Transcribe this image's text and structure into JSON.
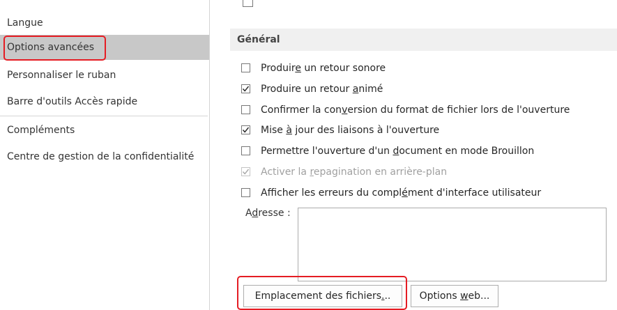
{
  "sidebar": {
    "items": [
      {
        "label": "Langue"
      },
      {
        "label": "Options avancées",
        "selected": true
      },
      {
        "label": "Personnaliser le ruban"
      },
      {
        "label": "Barre d'outils Accès rapide"
      },
      {
        "label": "Compléments"
      },
      {
        "label": "Centre de gestion de la confidentialité"
      }
    ]
  },
  "section": {
    "title": "Général"
  },
  "options": [
    {
      "pre": "Produir",
      "acc": "e",
      "post": " un retour sonore",
      "checked": false,
      "disabled": false
    },
    {
      "pre": "Produire un retour ",
      "acc": "a",
      "post": "nimé",
      "checked": true,
      "disabled": false
    },
    {
      "pre": "Confirmer la con",
      "acc": "v",
      "post": "ersion du format de fichier lors de l'ouverture",
      "checked": false,
      "disabled": false
    },
    {
      "pre": "Mise ",
      "acc": "à",
      "post": " jour des liaisons à l'ouverture",
      "checked": true,
      "disabled": false
    },
    {
      "pre": "Permettre l'ouverture d'un ",
      "acc": "d",
      "post": "ocument en mode Brouillon",
      "checked": false,
      "disabled": false
    },
    {
      "pre": "Activer la ",
      "acc": "r",
      "post": "epagination en arrière-plan",
      "checked": true,
      "disabled": true
    },
    {
      "pre": "Afficher les erreurs du compl",
      "acc": "é",
      "post": "ment d'interface utilisateur",
      "checked": false,
      "disabled": false
    }
  ],
  "address": {
    "label_pre": "A",
    "label_acc": "d",
    "label_post": "resse :",
    "value": ""
  },
  "buttons": {
    "file_locations": {
      "pre": "Emplacement des fichiers",
      "acc": ".",
      "post": ".."
    },
    "web_options": {
      "pre": "Options ",
      "acc": "w",
      "post": "eb..."
    }
  },
  "colors": {
    "highlight_red": "#e51c23",
    "selected_bg": "#c8c8c8",
    "section_bg": "#f0f0f0"
  }
}
